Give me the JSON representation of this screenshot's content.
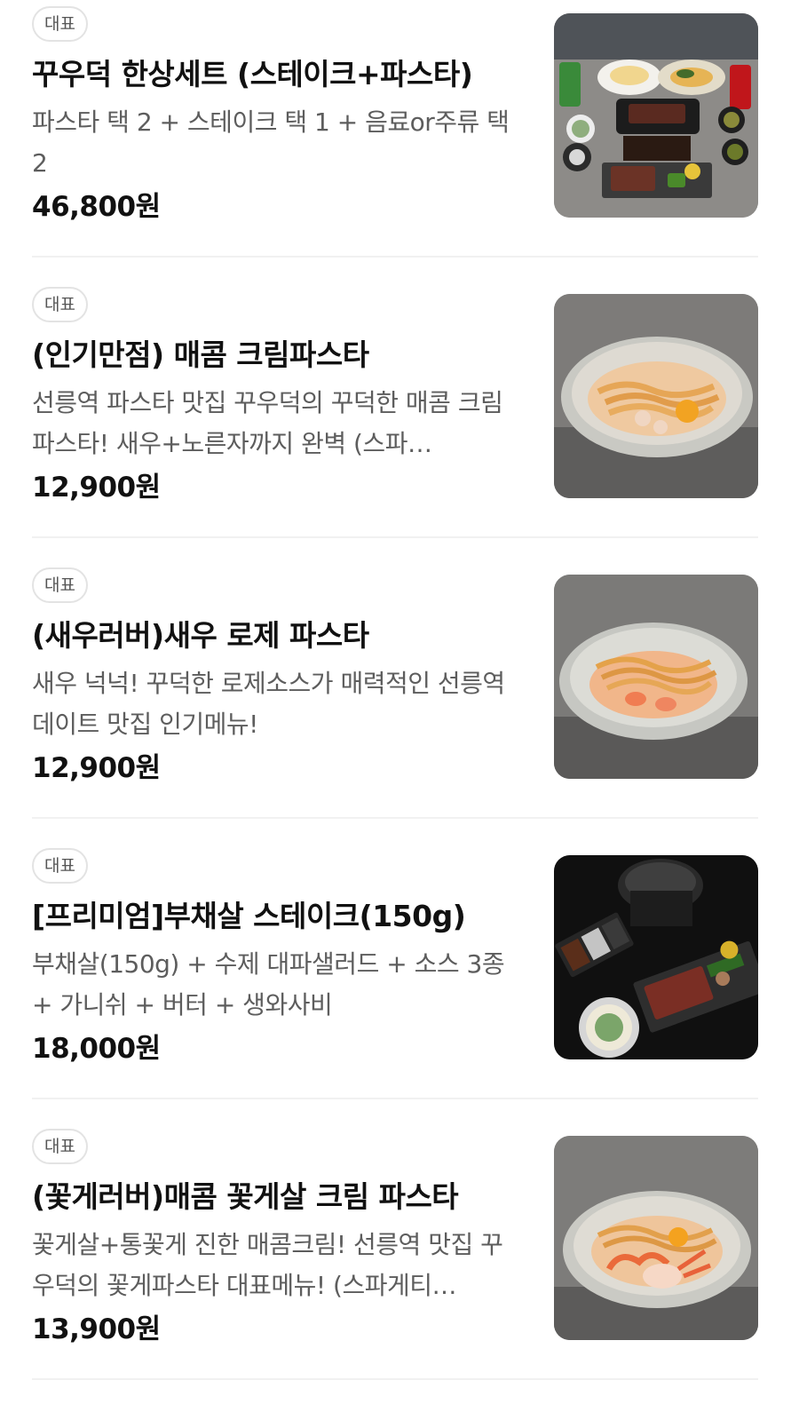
{
  "menu": {
    "items": [
      {
        "badge": "대표",
        "name": "꾸우덕 한상세트 (스테이크+파스타)",
        "description": "파스타 택 2 + 스테이크 택 1 + 음료or주류 택2",
        "price": "46,800원",
        "image": "set-meal-photo"
      },
      {
        "badge": "대표",
        "name": "(인기만점) 매콤 크림파스타",
        "description": "선릉역 파스타 맛집 꾸우덕의 꾸덕한 매콤 크림파스타! 새우+노른자까지 완벽 (스파…",
        "price": "12,900원",
        "image": "cream-pasta-photo"
      },
      {
        "badge": "대표",
        "name": "(새우러버)새우 로제 파스타",
        "description": "새우 넉넉! 꾸덕한 로제소스가 매력적인 선릉역 데이트 맛집 인기메뉴!",
        "price": "12,900원",
        "image": "rose-pasta-photo"
      },
      {
        "badge": "대표",
        "name": "[프리미엄]부채살 스테이크(150g)",
        "description": "부채살(150g) + 수제 대파샐러드 + 소스 3종 + 가니쉬 + 버터 + 생와사비",
        "price": "18,000원",
        "image": "steak-photo"
      },
      {
        "badge": "대표",
        "name": "(꽃게러버)매콤 꽃게살 크림 파스타",
        "description": "꽃게살+통꽃게 진한 매콤크림! 선릉역 맛집 꾸우덕의 꽃게파스타 대표메뉴! (스파게티…",
        "price": "13,900원",
        "image": "crab-pasta-photo"
      }
    ]
  }
}
